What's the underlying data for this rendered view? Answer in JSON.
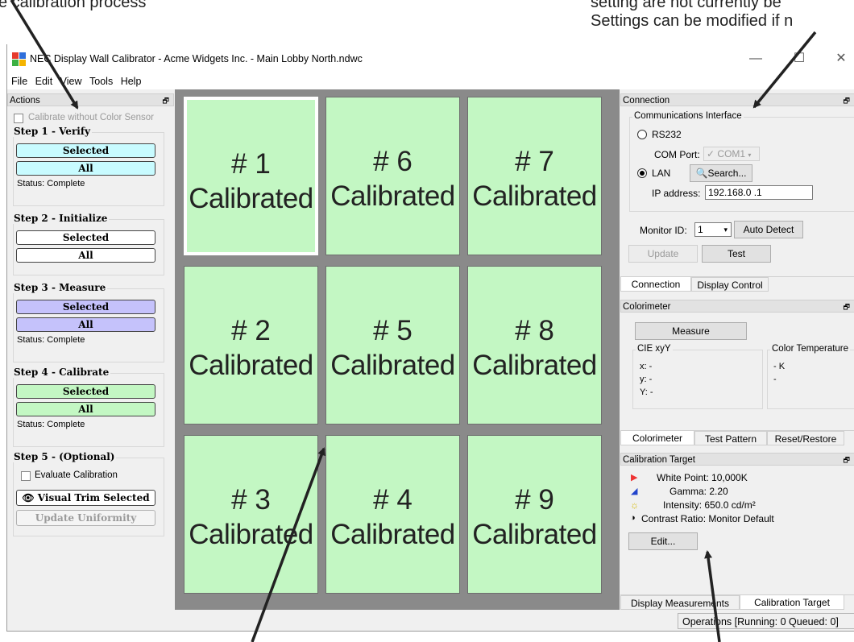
{
  "callouts": {
    "top_left": "e calibration process",
    "top_right_1": "setting are not currently be",
    "top_right_2": "Settings can be modified if n"
  },
  "window": {
    "title": "NEC Display Wall Calibrator - Acme Widgets Inc. - Main Lobby North.ndwc",
    "minimize": "—",
    "maximize": "☐",
    "close": "✕"
  },
  "menu": [
    "File",
    "Edit",
    "View",
    "Tools",
    "Help"
  ],
  "actions": {
    "header": "Actions",
    "pin": "🗗",
    "calibrate_without_sensor": "Calibrate without Color Sensor",
    "step1": {
      "label": "Step 1 - Verify",
      "selected": "Selected",
      "all": "All",
      "status": "Status: Complete",
      "color": "#c8fbff"
    },
    "step2": {
      "label": "Step 2 - Initialize",
      "selected": "Selected",
      "all": "All",
      "color": "#ffffff"
    },
    "step3": {
      "label": "Step 3 - Measure",
      "selected": "Selected",
      "all": "All",
      "status": "Status: Complete",
      "color": "#c5c2fb"
    },
    "step4": {
      "label": "Step 4 - Calibrate",
      "selected": "Selected",
      "all": "All",
      "status": "Status: Complete",
      "color": "#c3f7c3"
    },
    "step5": {
      "label": "Step 5 - (Optional)",
      "evaluate": "Evaluate Calibration",
      "visual_trim": "Visual Trim Selected",
      "update_uniformity": "Update Uniformity"
    }
  },
  "tiles": [
    {
      "num": "# 1",
      "label": "Calibrated",
      "selected": true
    },
    {
      "num": "# 6",
      "label": "Calibrated"
    },
    {
      "num": "# 7",
      "label": "Calibrated"
    },
    {
      "num": "# 2",
      "label": "Calibrated"
    },
    {
      "num": "# 5",
      "label": "Calibrated"
    },
    {
      "num": "# 8",
      "label": "Calibrated"
    },
    {
      "num": "# 3",
      "label": "Calibrated"
    },
    {
      "num": "# 4",
      "label": "Calibrated"
    },
    {
      "num": "# 9",
      "label": "Calibrated"
    }
  ],
  "connection": {
    "header": "Connection",
    "interface_label": "Communications Interface",
    "rs232": "RS232",
    "com_port_label": "COM Port:",
    "com_port_value": "COM1",
    "lan": "LAN",
    "search": "Search...",
    "ip_label": "IP address:",
    "ip_value": "192.168.0  .1",
    "monitor_id_label": "Monitor ID:",
    "monitor_id_value": "1",
    "auto_detect": "Auto Detect",
    "update": "Update",
    "test": "Test",
    "tabs": [
      "Connection",
      "Display Control"
    ]
  },
  "colorimeter": {
    "header": "Colorimeter",
    "measure": "Measure",
    "cie_label": "CIE xyY",
    "x": "x: -",
    "y": "y: -",
    "Y": "Y: -",
    "ct_label": "Color Temperature",
    "ct_value": "- K",
    "ct_dash": "-",
    "tabs": [
      "Colorimeter",
      "Test Pattern",
      "Reset/Restore"
    ]
  },
  "calibration_target": {
    "header": "Calibration Target",
    "white_point": "White Point: 10,000K",
    "gamma": "Gamma: 2.20",
    "intensity": "Intensity: 650.0 cd/m²",
    "contrast": "Contrast Ratio: Monitor Default",
    "edit": "Edit...",
    "tabs": [
      "Display Measurements",
      "Calibration Target"
    ]
  },
  "statusbar": "Operations [Running: 0 Queued: 0]"
}
